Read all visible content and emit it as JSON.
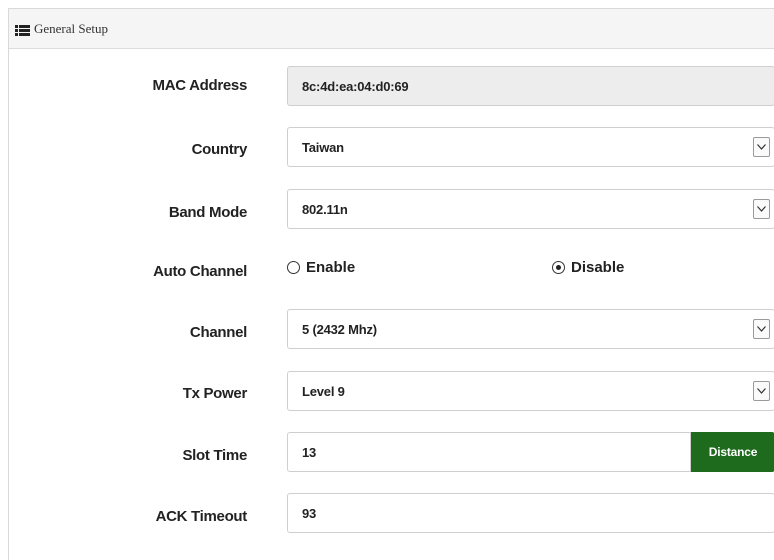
{
  "panel": {
    "title": "General Setup",
    "icon": "list-icon"
  },
  "fields": {
    "mac": {
      "label": "MAC Address",
      "value": "8c:4d:ea:04:d0:69"
    },
    "country": {
      "label": "Country",
      "value": "Taiwan"
    },
    "band_mode": {
      "label": "Band Mode",
      "value": "802.11n"
    },
    "auto_channel": {
      "label": "Auto Channel",
      "enable_label": "Enable",
      "disable_label": "Disable",
      "selected": "Disable"
    },
    "channel": {
      "label": "Channel",
      "value": "5 (2432 Mhz)"
    },
    "tx_power": {
      "label": "Tx Power",
      "value": "Level 9"
    },
    "slot_time": {
      "label": "Slot Time",
      "value": "13",
      "button_label": "Distance"
    },
    "ack_timeout": {
      "label": "ACK Timeout",
      "value": "93"
    }
  },
  "colors": {
    "accent_button": "#1e6b1e",
    "readonly_bg": "#ededed"
  }
}
